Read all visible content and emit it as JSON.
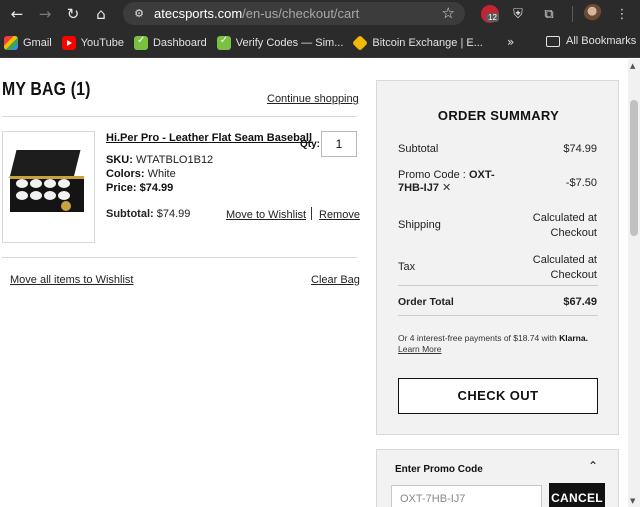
{
  "browser": {
    "url_host": "atecsports.com",
    "url_path": "/en-us/checkout/cart",
    "ext_badge": "12",
    "bookmarks": [
      {
        "label": "Gmail"
      },
      {
        "label": "YouTube"
      },
      {
        "label": "Dashboard"
      },
      {
        "label": "Verify Codes — Sim..."
      },
      {
        "label": "Bitcoin Exchange | E..."
      }
    ],
    "more_label": "»",
    "all_bookmarks": "All Bookmarks"
  },
  "bag": {
    "title": "MY BAG (1)",
    "continue_label": "Continue shopping",
    "item": {
      "name": "Hi.Per Pro - Leather Flat Seam Baseball",
      "sku_label": "SKU:",
      "sku": "WTATBLO1B12",
      "colors_label": "Colors:",
      "colors": "White",
      "price_label": "Price:",
      "price": "$74.99",
      "qty_label": "Qty:",
      "qty": "1",
      "subtotal_label": "Subtotal:",
      "subtotal": "$74.99",
      "move_to_wishlist": "Move to Wishlist",
      "remove": "Remove"
    },
    "move_all": "Move all items to Wishlist",
    "clear_bag": "Clear Bag"
  },
  "summary": {
    "title": "ORDER SUMMARY",
    "subtotal_label": "Subtotal",
    "subtotal": "$74.99",
    "promo_label": "Promo Code :",
    "promo_code_a": "OXT-",
    "promo_code_b": "7HB-IJ7",
    "promo_discount": "-$7.50",
    "shipping_label": "Shipping",
    "shipping_a": "Calculated at",
    "shipping_b": "Checkout",
    "tax_label": "Tax",
    "tax_a": "Calculated at",
    "tax_b": "Checkout",
    "total_label": "Order Total",
    "total": "$67.49",
    "klarna_text": "Or 4 interest-free payments of $18.74 with",
    "klarna_brand": "Klarna.",
    "learn_more": "Learn More",
    "checkout_label": "CHECK OUT"
  },
  "promo": {
    "title": "Enter Promo Code",
    "value": "OXT-7HB-IJ7",
    "cancel_label": "CANCEL"
  },
  "colors": {
    "accent": "#111111",
    "panel_bg": "#f2f2f2"
  }
}
